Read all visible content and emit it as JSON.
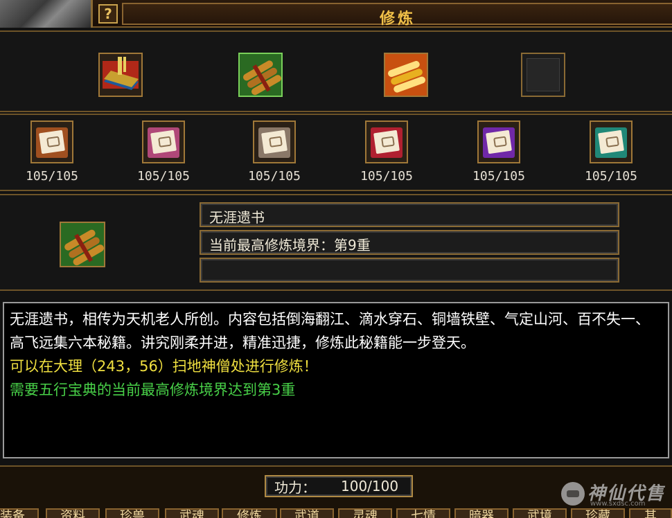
{
  "window": {
    "title": "修炼",
    "help_icon": "?"
  },
  "top_slots": [
    {
      "icon": "book-icon",
      "colors": [
        "#1d5a9a",
        "#c8a030",
        "#b02818"
      ],
      "selected": false
    },
    {
      "icon": "scroll-bundle-icon",
      "colors": [
        "#2a6a22",
        "#c88a28",
        "#8a2010"
      ],
      "selected": true
    },
    {
      "icon": "gold-bundle-icon",
      "colors": [
        "#e8b020",
        "#c85010",
        "#ffe080"
      ],
      "selected": false
    },
    {
      "icon": "empty-slot",
      "colors": [
        "#262626"
      ],
      "selected": false
    }
  ],
  "skill_scrolls": [
    {
      "color": "#a05020",
      "count": "105/105"
    },
    {
      "color": "#b04878",
      "count": "105/105"
    },
    {
      "color": "#8a7868",
      "count": "105/105"
    },
    {
      "color": "#b02030",
      "count": "105/105"
    },
    {
      "color": "#7028a8",
      "count": "105/105"
    },
    {
      "color": "#208878",
      "count": "105/105"
    }
  ],
  "selected_item": {
    "icon": "scroll-bundle-icon",
    "name": "无涯遗书",
    "realm": "当前最高修炼境界：第9重",
    "extra": ""
  },
  "description": {
    "line1": "无涯遗书，相传为天机老人所创。内容包括倒海翻江、滴水穿石、铜墙铁壁、气定山河、百不失一、高飞远集六本秘籍。讲究刚柔并进，精准迅捷，修炼此秘籍能一步登天。",
    "location": "可以在大理（243，56）扫地神僧处进行修炼！",
    "requirement": "需要五行宝典的当前最高修炼境界达到第3重"
  },
  "power": {
    "label": "功力：",
    "value": "100/100"
  },
  "tabs": [
    "装备",
    "资料",
    "珍兽",
    "武魂",
    "修炼",
    "武道",
    "灵魂",
    "七情",
    "暗器",
    "武境",
    "珍藏",
    "其"
  ],
  "watermark": {
    "text": "神仙代售",
    "url": "www.sxdsc.com"
  }
}
